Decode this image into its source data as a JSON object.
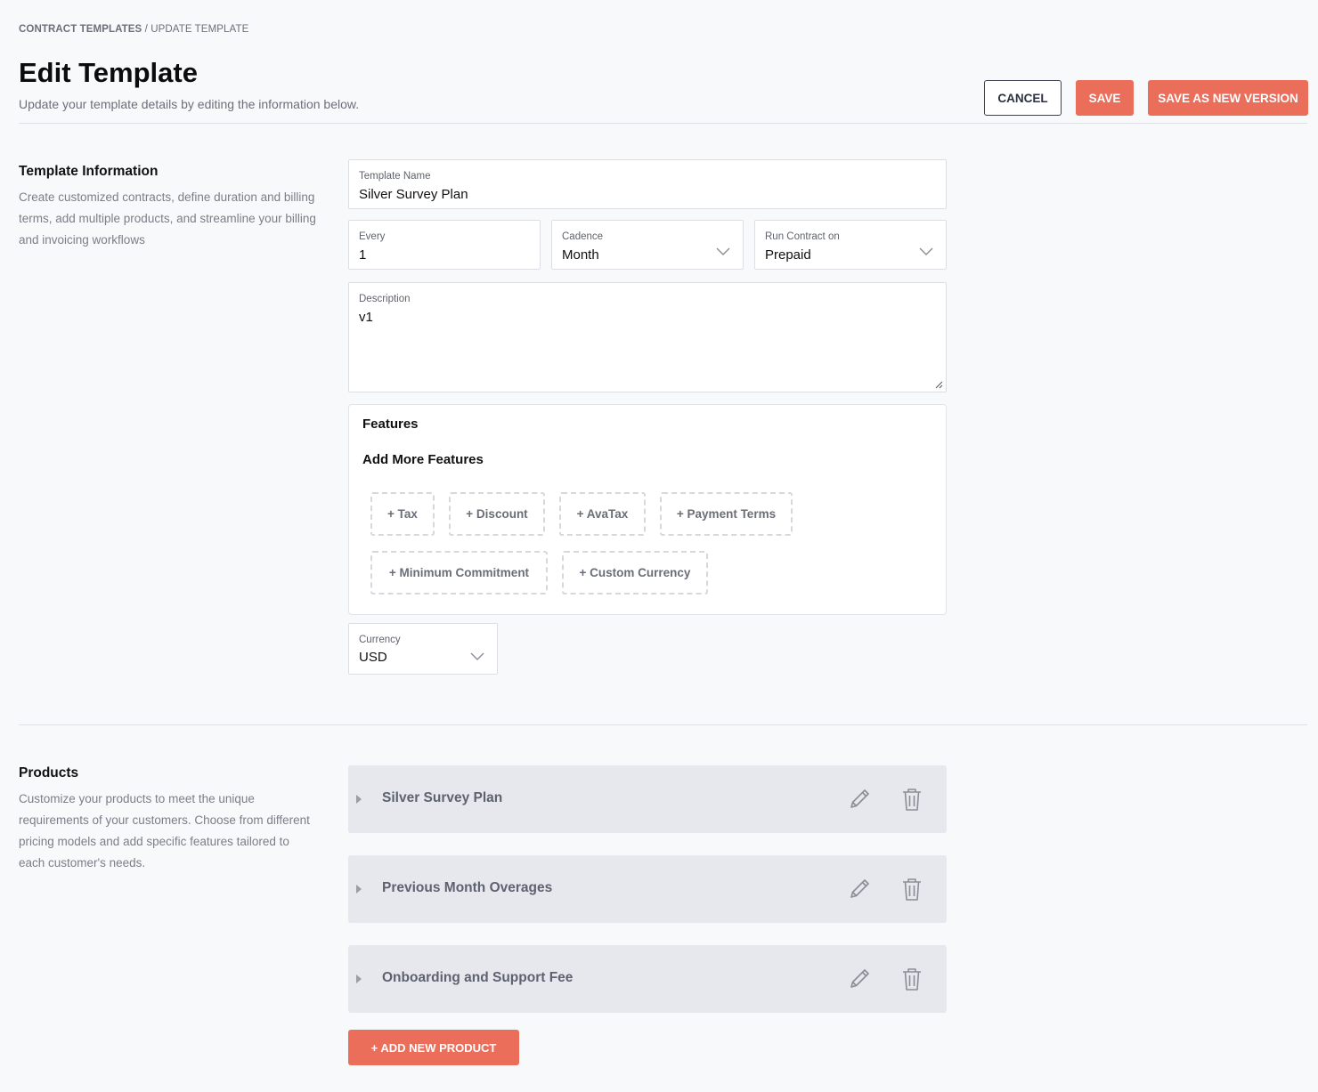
{
  "breadcrumb": {
    "parent": "CONTRACT TEMPLATES",
    "separator": " / ",
    "current": "UPDATE TEMPLATE"
  },
  "header": {
    "title": "Edit Template",
    "subtitle": "Update your template details by editing the information below."
  },
  "actions": {
    "cancel": "CANCEL",
    "save": "SAVE",
    "save_new_version": "SAVE AS NEW VERSION"
  },
  "template_info": {
    "title": "Template Information",
    "description": "Create customized contracts, define duration and billing terms, add multiple products, and streamline your billing and invoicing workflows"
  },
  "form": {
    "template_name": {
      "label": "Template Name",
      "value": "Silver Survey Plan"
    },
    "every": {
      "label": "Every",
      "value": "1"
    },
    "cadence": {
      "label": "Cadence",
      "value": "Month"
    },
    "run_contract_on": {
      "label": "Run Contract on",
      "value": "Prepaid"
    },
    "description": {
      "label": "Description",
      "value": "v1"
    },
    "currency": {
      "label": "Currency",
      "value": "USD"
    }
  },
  "features": {
    "title": "Features",
    "add_more": "Add More Features",
    "chips": [
      "+ Tax",
      "+ Discount",
      "+ AvaTax",
      "+ Payment Terms",
      "+ Minimum Commitment",
      "+ Custom Currency"
    ]
  },
  "products": {
    "title": "Products",
    "description": "Customize your products to meet the unique requirements of your customers. Choose from different pricing models and add specific features tailored to each customer's needs.",
    "items": [
      {
        "name": "Silver Survey Plan"
      },
      {
        "name": "Previous Month Overages"
      },
      {
        "name": "Onboarding and Support Fee"
      }
    ],
    "add_button": "+ ADD NEW PRODUCT"
  },
  "colors": {
    "primary": "#ea6e5a",
    "product_row_bg": "#e7e8ee",
    "page_bg": "#f8f9fb"
  }
}
